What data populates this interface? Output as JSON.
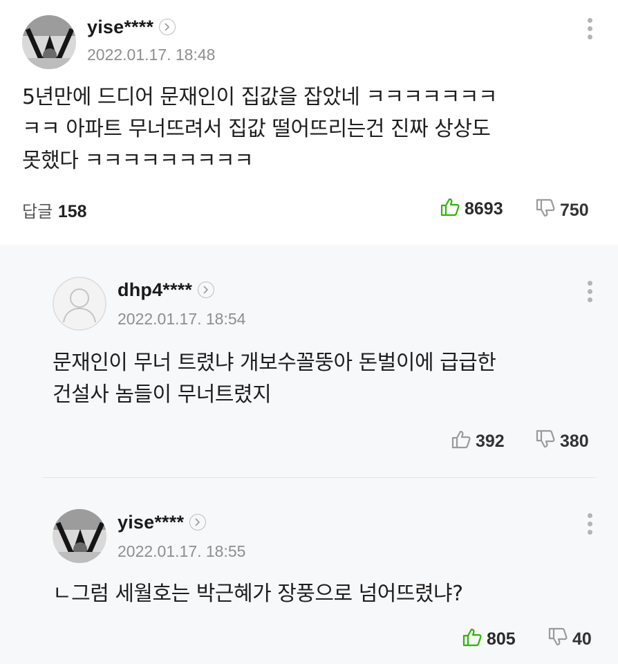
{
  "comments": [
    {
      "nickname": "yise****",
      "date": "2022.01.17. 18:48",
      "lines": [
        "5년만에 드디어 문재인이 집값을 잡았네 ㅋㅋㅋㅋㅋㅋㅋ",
        "ㅋㅋ 아파트 무너뜨려서 집값 떨어뜨리는건 진짜 상상도",
        "못했다 ㅋㅋㅋㅋㅋㅋㅋㅋㅋ"
      ],
      "reply_label": "답글",
      "reply_count": "158",
      "likes": "8693",
      "dislikes": "750",
      "avatar_icon": "profile-photo"
    },
    {
      "nickname": "dhp4****",
      "date": "2022.01.17. 18:54",
      "lines": [
        "문재인이 무너 트렸냐 개보수꼴뚱아 돈벌이에 급급한",
        "건설사 놈들이 무너트렸지"
      ],
      "likes": "392",
      "dislikes": "380",
      "avatar_icon": "default-user-icon"
    },
    {
      "nickname": "yise****",
      "date": "2022.01.17. 18:55",
      "lines": [
        "ㄴ그럼 세월호는 박근혜가 장풍으로 넘어뜨렸냐?"
      ],
      "likes": "805",
      "dislikes": "40",
      "avatar_icon": "profile-photo"
    }
  ],
  "colors": {
    "like_active": "#2db400",
    "icon_gray": "#9a9a9a",
    "date_gray": "#8e8e8e",
    "reply_background": "#f7f8f9"
  }
}
